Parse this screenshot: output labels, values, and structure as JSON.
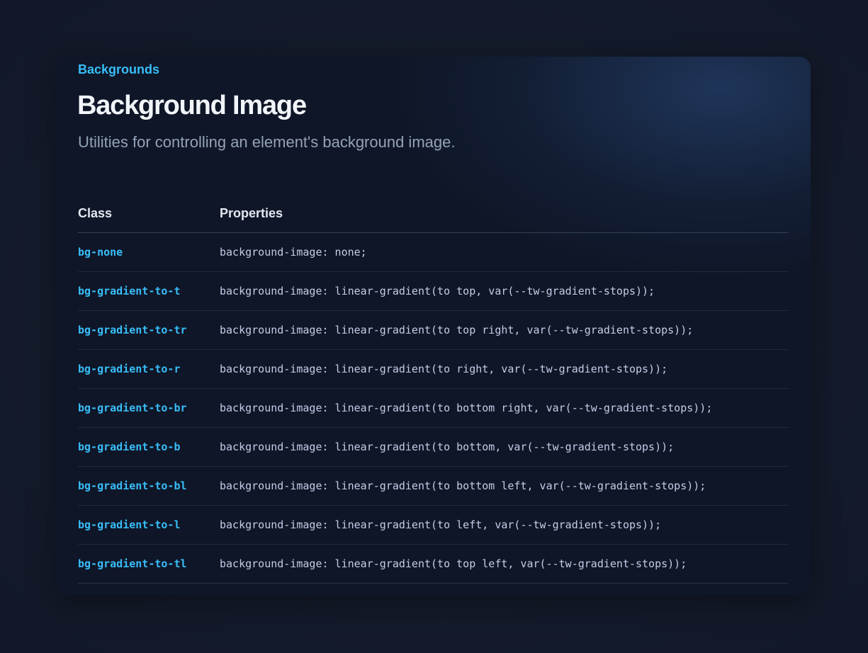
{
  "header": {
    "eyebrow": "Backgrounds",
    "title": "Background Image",
    "subtitle": "Utilities for controlling an element's background image."
  },
  "table": {
    "headers": {
      "class": "Class",
      "properties": "Properties"
    },
    "rows": [
      {
        "class": "bg-none",
        "properties": "background-image: none;"
      },
      {
        "class": "bg-gradient-to-t",
        "properties": "background-image: linear-gradient(to top, var(--tw-gradient-stops));"
      },
      {
        "class": "bg-gradient-to-tr",
        "properties": "background-image: linear-gradient(to top right, var(--tw-gradient-stops));"
      },
      {
        "class": "bg-gradient-to-r",
        "properties": "background-image: linear-gradient(to right, var(--tw-gradient-stops));"
      },
      {
        "class": "bg-gradient-to-br",
        "properties": "background-image: linear-gradient(to bottom right, var(--tw-gradient-stops));"
      },
      {
        "class": "bg-gradient-to-b",
        "properties": "background-image: linear-gradient(to bottom, var(--tw-gradient-stops));"
      },
      {
        "class": "bg-gradient-to-bl",
        "properties": "background-image: linear-gradient(to bottom left, var(--tw-gradient-stops));"
      },
      {
        "class": "bg-gradient-to-l",
        "properties": "background-image: linear-gradient(to left, var(--tw-gradient-stops));"
      },
      {
        "class": "bg-gradient-to-tl",
        "properties": "background-image: linear-gradient(to top left, var(--tw-gradient-stops));"
      }
    ]
  },
  "colors": {
    "accent": "#38bdf8",
    "title": "#f1f5f9",
    "subtitle": "#94a3b8",
    "card_background": "#0f1627"
  }
}
